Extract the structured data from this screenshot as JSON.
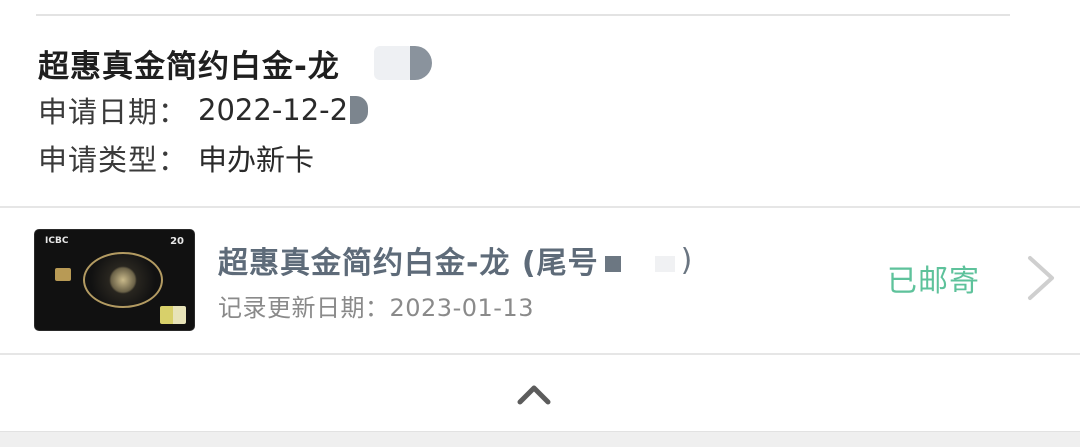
{
  "application": {
    "title": "超惠真金简约白金-龙",
    "date_label": "申请日期：",
    "date_value": "2022-12-2",
    "type_label": "申请类型：",
    "type_value": "申办新卡"
  },
  "card": {
    "bank_mark": "ICBC",
    "card_badge": "20",
    "name": "超惠真金简约白金-龙 (尾号",
    "name_close": ")",
    "update_text": "记录更新日期：2023-01-13",
    "status": "已邮寄"
  },
  "colors": {
    "status": "#5ec29b",
    "card_name": "#5e6b79",
    "chevron": "#cfcfcf",
    "collapse_arrow": "#5c5c5c"
  },
  "icons": {
    "chevron": "chevron-right-icon",
    "collapse": "chevron-up-icon"
  }
}
